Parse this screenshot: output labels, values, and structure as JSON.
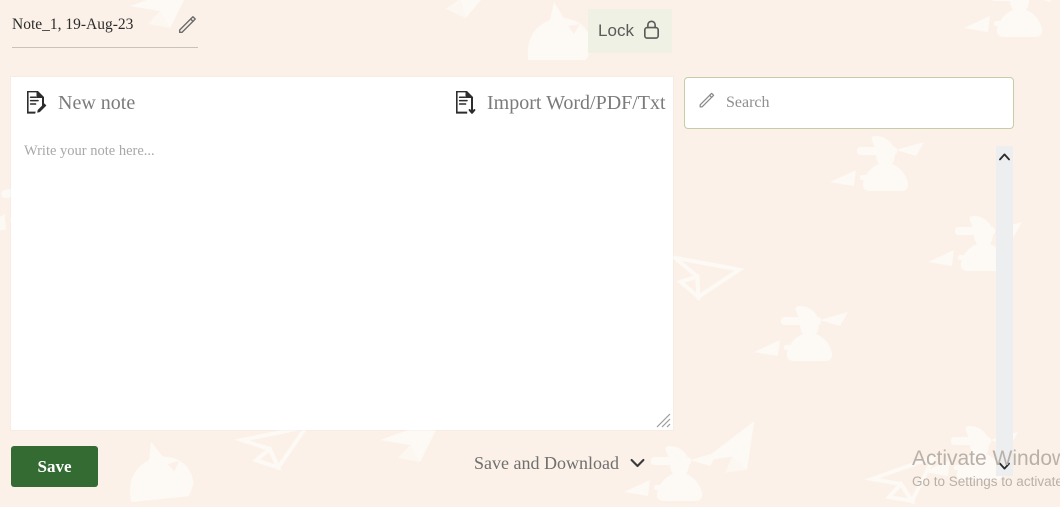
{
  "app": {
    "background_color": "#fbf1e8",
    "accent_green": "#336b33",
    "lock_bg": "#eef1e4",
    "search_border": "#c4cda8"
  },
  "header": {
    "note_title": "Note_1, 19-Aug-23",
    "edit_icon": "pencil-icon",
    "lock": {
      "label": "Lock",
      "icon": "lock-icon"
    }
  },
  "editor": {
    "toolbar": {
      "new_note": {
        "label": "New note",
        "icon": "note-edit-icon"
      },
      "import": {
        "label": "Import Word/PDF/Txt",
        "icon": "document-download-icon"
      }
    },
    "textarea": {
      "placeholder": "Write your note here...",
      "value": ""
    },
    "resize_grip_icon": "resize-grip-icon"
  },
  "search": {
    "placeholder": "Search",
    "value": "",
    "icon": "pencil-icon"
  },
  "results_scrollbar": {
    "up_icon": "chevron-up-icon",
    "down_icon": "chevron-down-icon"
  },
  "footer": {
    "save_label": "Save",
    "save_and_download_label": "Save and Download",
    "save_and_download_icon": "chevron-down-icon"
  },
  "watermark": {
    "title": "Activate Windows",
    "subtitle": "Go to Settings to activate Windows."
  }
}
